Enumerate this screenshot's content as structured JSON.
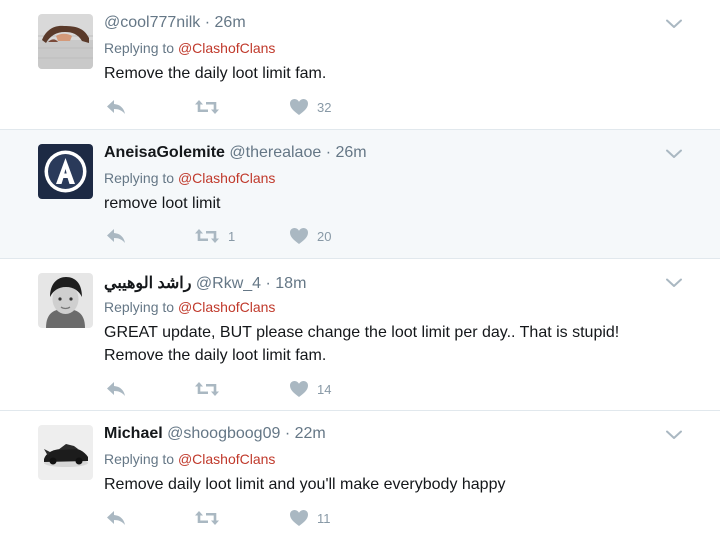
{
  "tweets": [
    {
      "name": "",
      "handle": "@cool777nilk",
      "time": "· 26m",
      "replying_prefix": "Replying to",
      "replying_to": "@ClashofClans",
      "text": "Remove the daily loot limit fam.",
      "retweets": "",
      "likes": "32"
    },
    {
      "name": "AneisaGolemite",
      "handle": "@therealaoe",
      "time": "· 26m",
      "replying_prefix": "Replying to",
      "replying_to": "@ClashofClans",
      "text": "remove loot limit",
      "retweets": "1",
      "likes": "20"
    },
    {
      "name": "راشد الوهيبي",
      "handle": "@Rkw_4",
      "time": "· 18m",
      "replying_prefix": "Replying to",
      "replying_to": "@ClashofClans",
      "text_line1": "GREAT update, BUT please change the loot limit per day.. That is stupid!",
      "text_line2": "Remove the daily loot limit fam.",
      "retweets": "",
      "likes": "14"
    },
    {
      "name": "Michael",
      "handle": "@shoogboog09",
      "time": "· 22m",
      "replying_prefix": "Replying to",
      "replying_to": "@ClashofClans",
      "text": "Remove daily loot limit and you'll make everybody happy",
      "retweets": "",
      "likes": "11"
    }
  ],
  "colors": {
    "mention": "#c0392b",
    "secondary": "#657786",
    "icon": "#aab8c2",
    "divider": "#e1e8ed",
    "highlight_bg": "#f5f8fa"
  },
  "icons": [
    "reply-icon",
    "retweet-icon",
    "heart-icon",
    "chevron-down-icon"
  ]
}
